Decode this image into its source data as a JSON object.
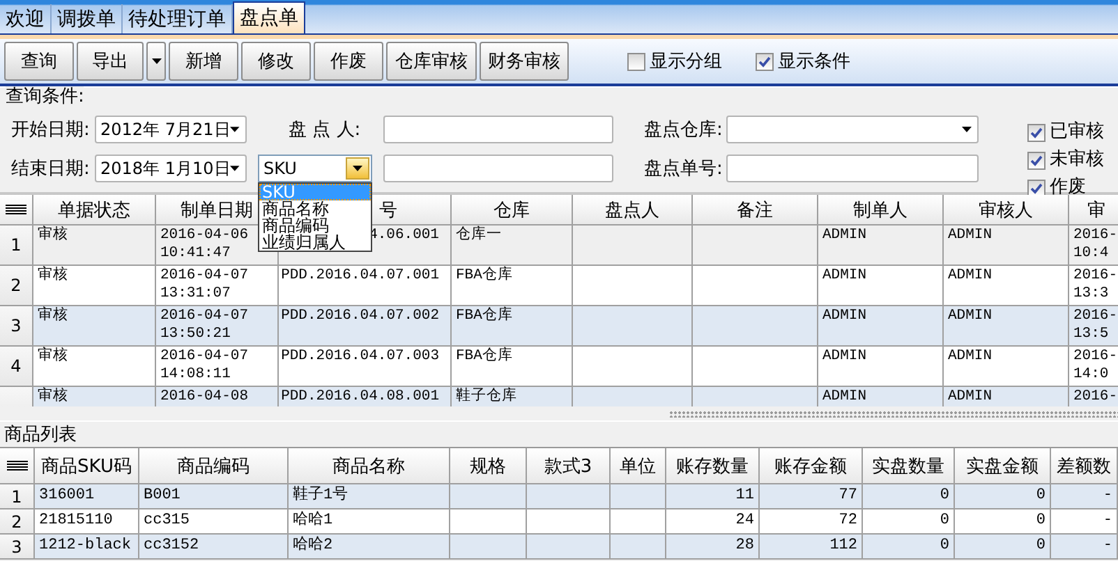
{
  "tabs": [
    {
      "label": "欢迎",
      "selected": false
    },
    {
      "label": "调拨单",
      "selected": false
    },
    {
      "label": "待处理订单",
      "selected": false
    },
    {
      "label": "盘点单",
      "selected": true
    }
  ],
  "toolbar": {
    "buttons": [
      {
        "label": "查询",
        "kind": "button"
      },
      {
        "label": "导出",
        "kind": "split"
      },
      {
        "label": "新增",
        "kind": "button"
      },
      {
        "label": "修改",
        "kind": "button"
      },
      {
        "label": "作废",
        "kind": "button"
      },
      {
        "label": "仓库审核",
        "kind": "button"
      },
      {
        "label": "财务审核",
        "kind": "button"
      }
    ],
    "options": [
      {
        "label": "显示分组",
        "checked": false
      },
      {
        "label": "显示条件",
        "checked": true
      }
    ]
  },
  "query": {
    "title": "查询条件:",
    "start_date": {
      "label": "开始日期:",
      "value": "2012年 7月21日"
    },
    "end_date": {
      "label": "结束日期:",
      "value": "2018年 1月10日"
    },
    "counter": {
      "label": "盘 点 人:"
    },
    "warehouse": {
      "label": "盘点仓库:"
    },
    "order_no": {
      "label": "盘点单号:"
    },
    "search_by": {
      "value": "SKU",
      "expanded": true,
      "options": [
        {
          "label": "SKU",
          "selected": true
        },
        {
          "label": "商品名称",
          "selected": false
        },
        {
          "label": "商品编码",
          "selected": false
        },
        {
          "label": "业绩归属人",
          "selected": false
        }
      ]
    },
    "status_filters": [
      {
        "label": "已审核",
        "checked": true
      },
      {
        "label": "未审核",
        "checked": true
      },
      {
        "label": "作废",
        "checked": true
      }
    ]
  },
  "orders": {
    "columns": [
      "单据状态",
      "制单日期",
      "号",
      "仓库",
      "盘点人",
      "备注",
      "制单人",
      "审核人",
      "审"
    ],
    "rows": [
      {
        "number": "1",
        "selected": true,
        "cells": [
          "审核",
          "2016-04-06\n10:41:47",
          "4.06.001",
          "仓库一",
          null,
          null,
          "ADMIN",
          "ADMIN",
          "2016-\n10:4"
        ]
      },
      {
        "number": "2",
        "selected": false,
        "cells": [
          "审核",
          "2016-04-07\n13:31:07",
          "PDD.2016.04.07.001",
          "FBA仓库",
          null,
          null,
          "ADMIN",
          "ADMIN",
          "2016-\n13:3"
        ]
      },
      {
        "number": "3",
        "selected": false,
        "cells": [
          "审核",
          "2016-04-07\n13:50:21",
          "PDD.2016.04.07.002",
          "FBA仓库",
          null,
          null,
          "ADMIN",
          "ADMIN",
          "2016-\n13:5"
        ]
      },
      {
        "number": "4",
        "selected": false,
        "cells": [
          "审核",
          "2016-04-07\n14:08:11",
          "PDD.2016.04.07.003",
          "FBA仓库",
          null,
          null,
          "ADMIN",
          "ADMIN",
          "2016-\n14:0"
        ]
      },
      {
        "selected": false,
        "cells": [
          "审核",
          "2016-04-08",
          "PDD.2016.04.08.001",
          "鞋子仓库",
          null,
          null,
          "ADMIN",
          "ADMIN",
          "2016-"
        ]
      }
    ]
  },
  "item_list": {
    "title": "商品列表",
    "columns": [
      "商品SKU码",
      "商品编码",
      "商品名称",
      "规格",
      "款式3",
      "单位",
      "账存数量",
      "账存金额",
      "实盘数量",
      "实盘金额",
      "差额数"
    ],
    "rows": [
      {
        "number": "1",
        "cells": [
          "316001",
          "B001",
          "鞋子1号",
          null,
          null,
          null,
          "11",
          "77",
          "0",
          "0",
          "-"
        ]
      },
      {
        "number": "2",
        "cells": [
          "21815110",
          "cc315",
          "哈哈1",
          null,
          null,
          null,
          "24",
          "72",
          "0",
          "0",
          "-"
        ]
      },
      {
        "number": "3",
        "cells": [
          "1212-black",
          "cc3152",
          "哈哈2",
          null,
          null,
          null,
          "28",
          "112",
          "0",
          "0",
          "-"
        ]
      }
    ]
  }
}
